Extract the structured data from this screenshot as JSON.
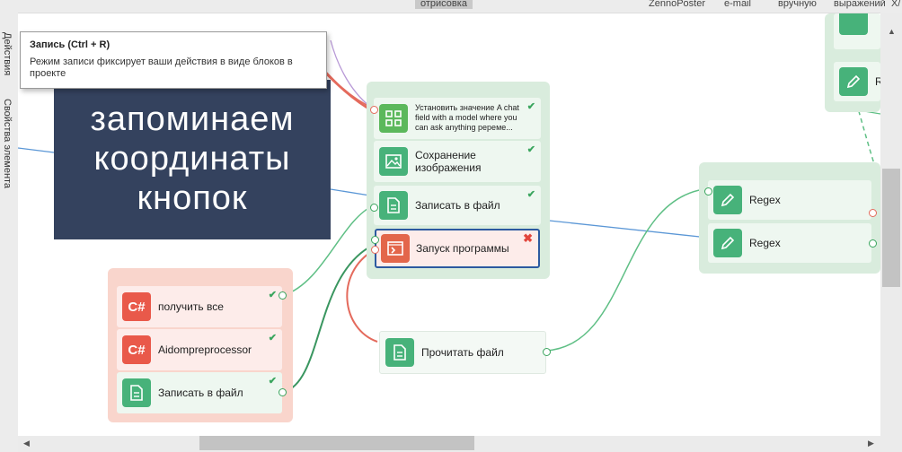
{
  "topbar": {
    "tab_drawing": "отрисовка",
    "zennoposter": "ZennoPoster",
    "email": "e-mail",
    "manual": "вручную",
    "expressions": "выражений",
    "cut": "X/"
  },
  "side_tabs": {
    "actions": "Действия",
    "element_props": "Свойства элемента"
  },
  "tooltip": {
    "title": "Запись (Ctrl + R)",
    "text": "Режим записи фиксирует ваши действия в виде блоков в проекте"
  },
  "overlay": {
    "line1": "запоминаем",
    "line2": "координаты",
    "line3": "кнопок"
  },
  "blocks": {
    "set_value": "Установить значение A chat field with a model where you can ask anything peреме...",
    "save_image": "Сохранение изображения",
    "write_file_top": "Записать в файл",
    "run_program": "Запуск программы",
    "get_all": "получить все",
    "aidom": "Aidompreprocessor",
    "write_file_bottom": "Записать в файл",
    "read_file": "Прочитать файл",
    "regex1": "Regex",
    "regex2": "Regex",
    "r_cut": "Re"
  },
  "icons": {
    "csharp": "C#",
    "grid": "grid-icon",
    "image": "image-icon",
    "file": "file-icon",
    "terminal": "terminal-icon",
    "pencil": "pencil-icon"
  },
  "colors": {
    "green_group": "#d9ecdd",
    "red_group": "#f9d5cc",
    "green_icon": "#47b27a",
    "red_icon": "#e9594a",
    "overlay_bg": "#34425e",
    "selected_border": "#2c5aa0"
  }
}
